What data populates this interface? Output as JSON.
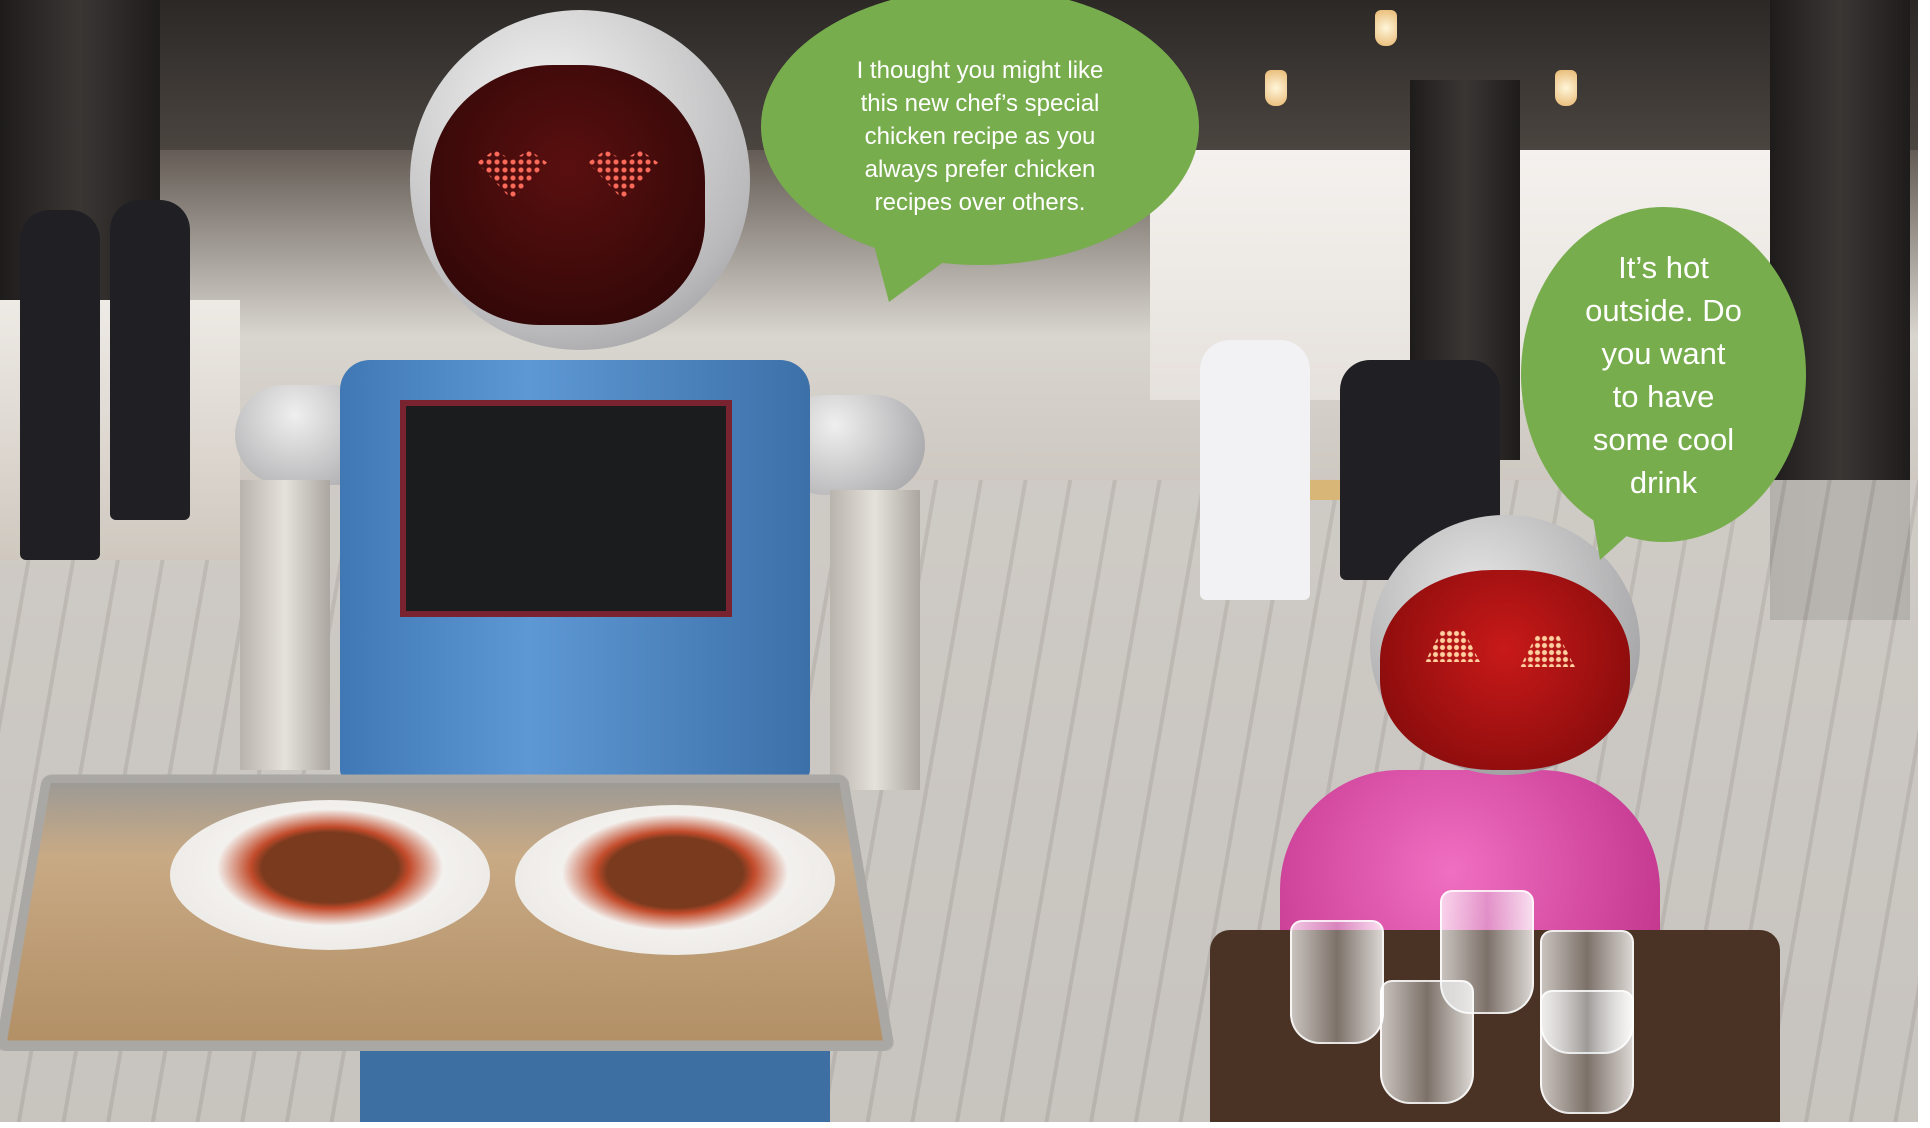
{
  "scene": {
    "description_colors": {
      "bubble": "#78ad4e",
      "bubble_text": "#ffffff",
      "robot_left_body": "#4f8ac6",
      "robot_right_body": "#d94fa6"
    }
  },
  "bubbles": [
    {
      "text": "I thought you might like\nthis new chef’s special\nchicken recipe as you\nalways prefer chicken\nrecipes over others."
    },
    {
      "text": "It’s hot\noutside. Do\nyou want\nto have\nsome cool\ndrink"
    }
  ]
}
